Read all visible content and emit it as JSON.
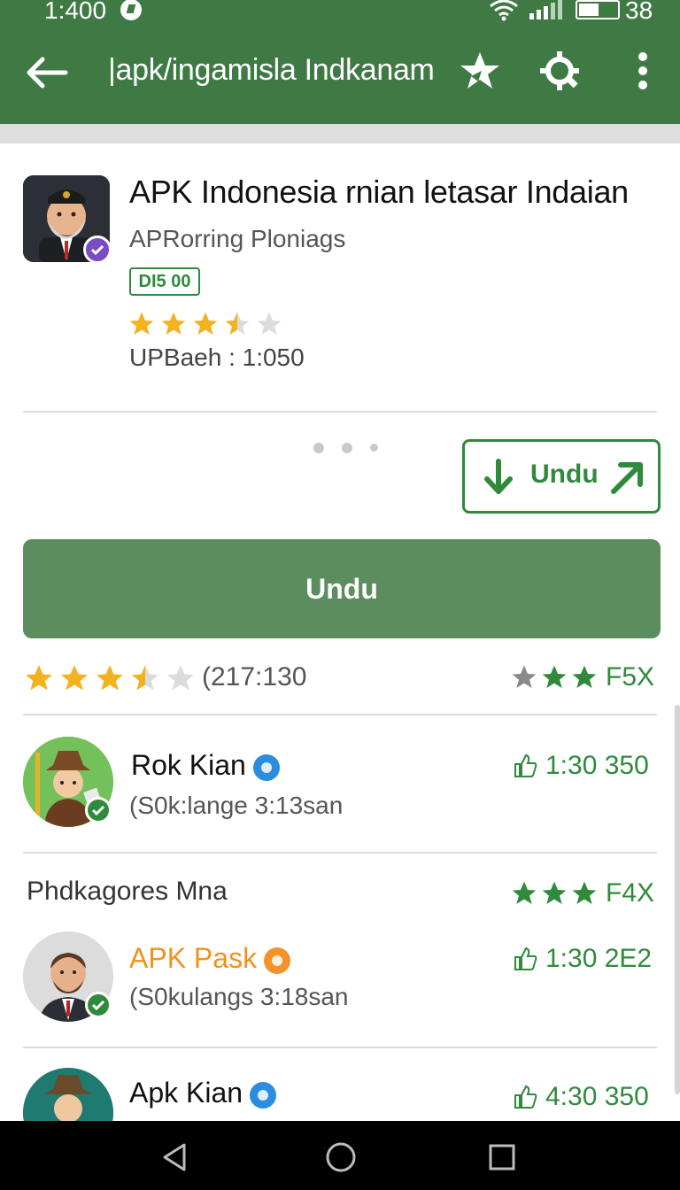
{
  "status_bar": {
    "time": "1:400",
    "battery_text": "38"
  },
  "toolbar": {
    "title": "|apk/ingamisla Indkanam"
  },
  "app": {
    "title": "APK Indonesia rnian letasar Indaian",
    "developer": "APRorring Ploniags",
    "badge": "DI5 00",
    "rating_stars": 3.5,
    "updated": "UPBaeh : 1:050"
  },
  "actions": {
    "outline_button_label": "Undu",
    "main_button_label": "Undu"
  },
  "rating": {
    "stars": 3.5,
    "count_text": "(217:130",
    "score_text": "F5X"
  },
  "list": {
    "items": [
      {
        "name": "Rok Kian",
        "subtitle": "(S0k:lange 3:13san",
        "count": "1:30 350",
        "badge_color": "#2a8de0",
        "name_color": "#111111"
      },
      {
        "name": "APK Pask",
        "subtitle": "(S0kulangs 3:18san",
        "count": "1:30 2E2",
        "badge_color": "#f5922a",
        "name_color": "#f0921e"
      },
      {
        "name": "Apk Kian",
        "subtitle": "",
        "count": "4:30 350",
        "badge_color": "#2a8de0",
        "name_color": "#111111"
      }
    ],
    "section_title": "Phdkagores Mna",
    "section_score": "F4X"
  },
  "colors": {
    "accent": "#3f7a45",
    "primary_green": "#2f8a3c",
    "button_green": "#5b8d5e",
    "star_gold": "#f3b21e"
  }
}
